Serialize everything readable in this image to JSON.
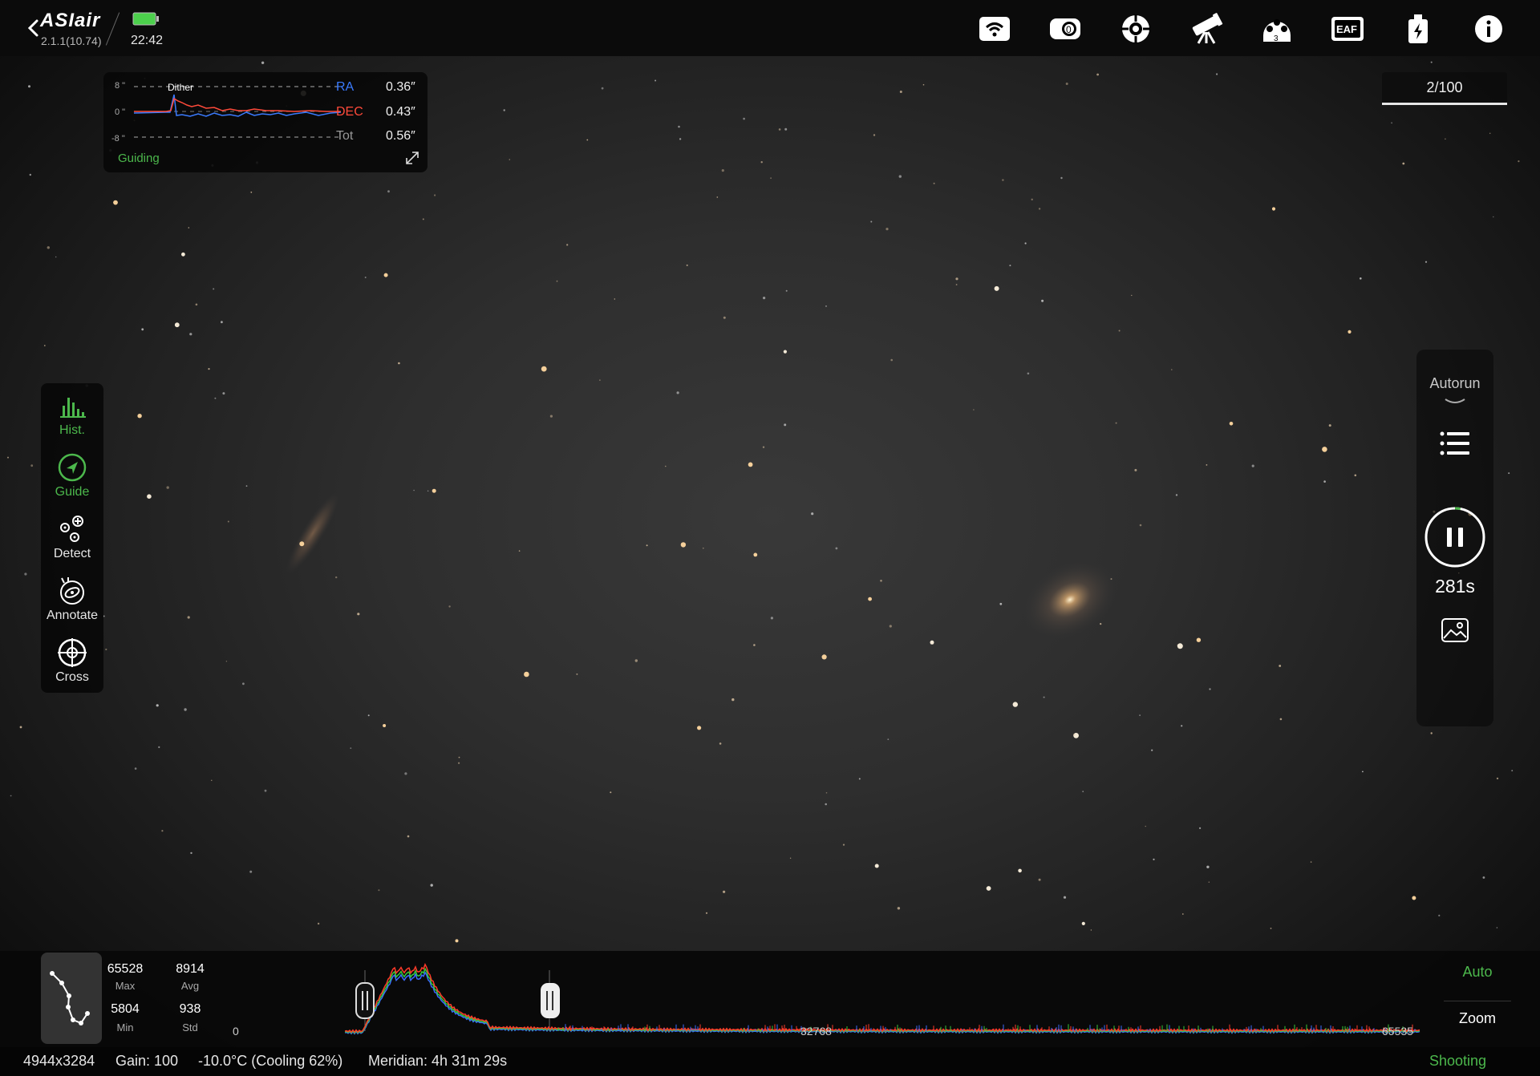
{
  "app": {
    "name": "ASIair",
    "version": "2.1.1(10.74)",
    "time": "22:42"
  },
  "top_icons": [
    "wifi-icon",
    "camera-icon",
    "guide-camera-icon",
    "telescope-icon",
    "filter-wheel-icon",
    "eaf-focuser-icon",
    "power-usb-icon",
    "info-icon"
  ],
  "top_icon_texts": {
    "filter_wheel_position": "3",
    "focuser": "EAF"
  },
  "guiding": {
    "axis_top": "8 \"",
    "axis_mid": "0 \"",
    "axis_bottom": "-8 \"",
    "event": "Dither",
    "ra_label": "RA",
    "ra_value": "0.36″",
    "dec_label": "DEC",
    "dec_value": "0.43″",
    "tot_label": "Tot",
    "tot_value": "0.56″",
    "status": "Guiding",
    "colors": {
      "ra": "#3a7bff",
      "dec": "#ff4a3a",
      "status": "#4cb84c"
    }
  },
  "frame_counter": "2/100",
  "left_tools": [
    {
      "label": "Hist.",
      "icon": "histogram-icon",
      "active": true
    },
    {
      "label": "Guide",
      "icon": "guide-icon",
      "active": true
    },
    {
      "label": "Detect",
      "icon": "detect-stars-icon",
      "active": false
    },
    {
      "label": "Annotate",
      "icon": "annotate-galaxy-icon",
      "active": false
    },
    {
      "label": "Cross",
      "icon": "crosshair-icon",
      "active": false
    }
  ],
  "autorun": {
    "label": "Autorun",
    "countdown": "281s",
    "progress": 0.03
  },
  "histogram_stats": {
    "max": "65528",
    "max_label": "Max",
    "avg": "8914",
    "avg_label": "Avg",
    "min": "5804",
    "min_label": "Min",
    "std": "938",
    "std_label": "Std"
  },
  "histogram_axis": {
    "start": "0",
    "mid": "32768",
    "end": "65535"
  },
  "histogram_stretch": {
    "black_point": 0.0,
    "white_point": 0.136
  },
  "buttons": {
    "auto": "Auto",
    "zoom": "Zoom"
  },
  "status_bar": {
    "resolution": "4944x3284",
    "gain": "Gain: 100",
    "temperature": "-10.0°C (Cooling 62%)",
    "meridian": "Meridian: 4h 31m 29s",
    "state": "Shooting"
  }
}
